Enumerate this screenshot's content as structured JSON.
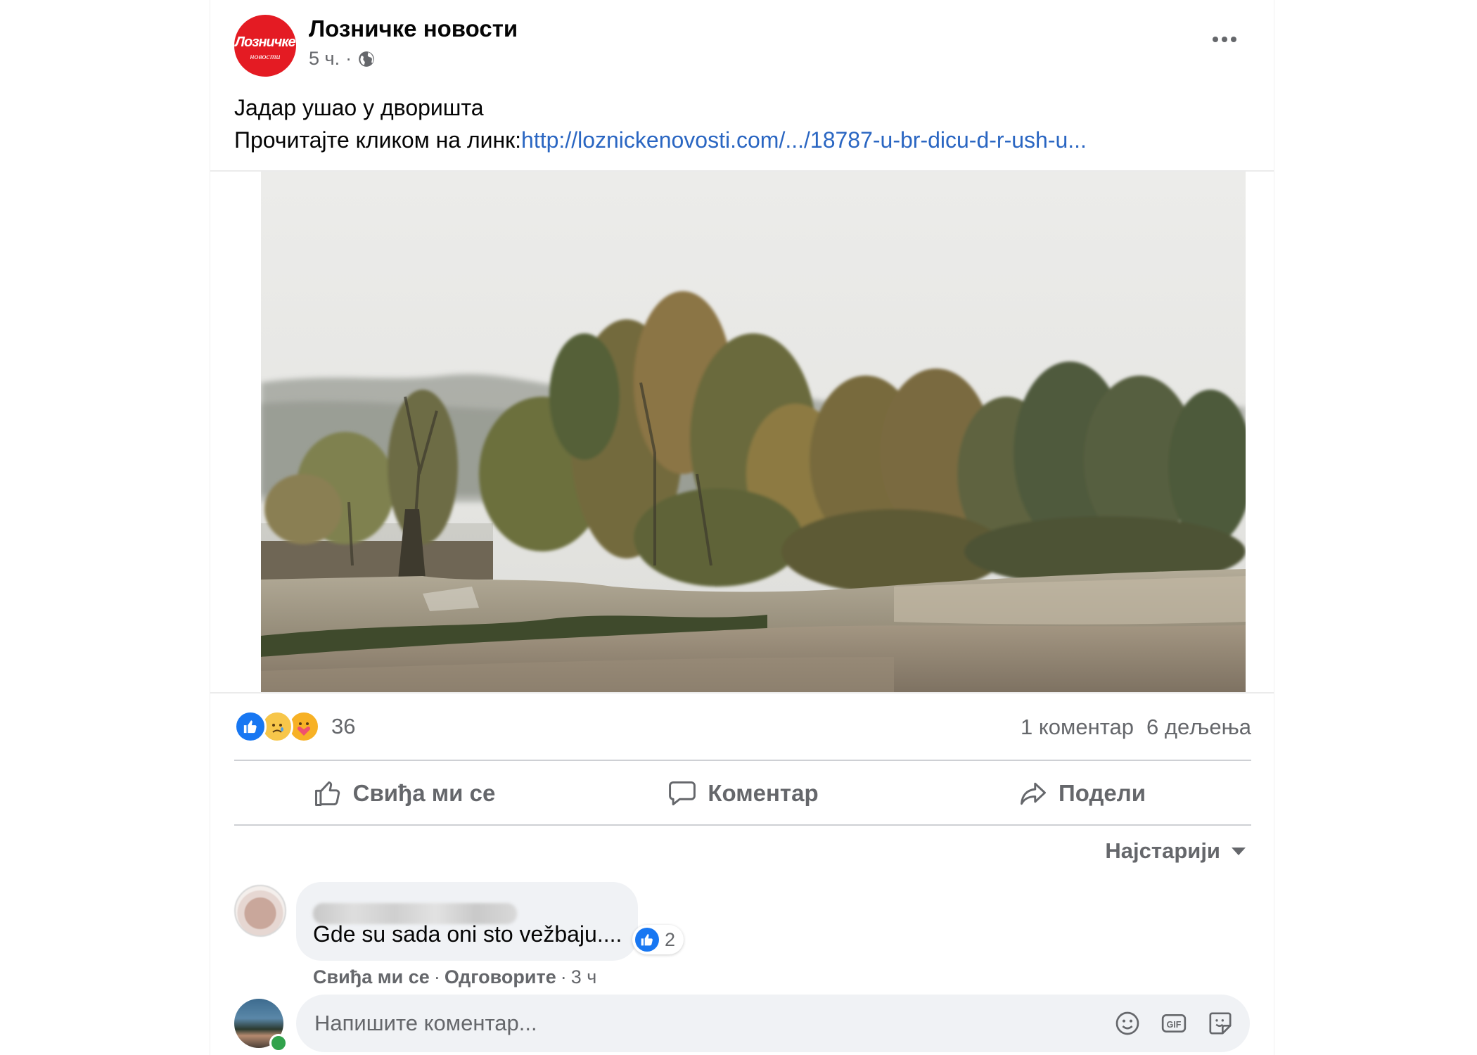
{
  "post": {
    "page_name": "Лозничке новости",
    "logo_text_top": "Лозничке",
    "logo_text_bottom": "новости",
    "time": "5 ч.",
    "meta_separator": "·",
    "text_line1": "Јадар ушао у дворишта",
    "text_line2_prefix": "Прочитајте кликом на линк:",
    "link_text": "http://loznickenovosti.com/.../18787-u-br-dicu-d-r-ush-u..."
  },
  "stats": {
    "reaction_count": "36",
    "comments": "1 коментар",
    "shares": "6 дељења",
    "reactions": [
      "like-reaction",
      "sad-reaction",
      "care-reaction"
    ]
  },
  "actions": {
    "like": "Свиђа ми се",
    "comment": "Коментар",
    "share": "Подели"
  },
  "sort": {
    "label": "Најстарији"
  },
  "comment": {
    "text": "Gde su sada oni sto vežbaju....",
    "reaction_count": "2",
    "like_action": "Свиђа ми се",
    "reply_action": "Одговорите",
    "time": "3 ч",
    "separator": "·"
  },
  "composer": {
    "placeholder": "Напишите коментар..."
  },
  "colors": {
    "link": "#2a66c2",
    "like_blue": "#1877f2",
    "secondary_text": "#65676b",
    "bubble": "#f0f2f5",
    "logo_red": "#e41b23",
    "online": "#31a24c"
  },
  "icons": {
    "more": "more-options-icon",
    "globe": "globe-icon",
    "like": "thumbs-up-icon",
    "comment": "comment-bubble-icon",
    "share": "share-arrow-icon",
    "emoji": "emoji-icon",
    "gif": "gif-icon",
    "sticker": "sticker-icon"
  }
}
